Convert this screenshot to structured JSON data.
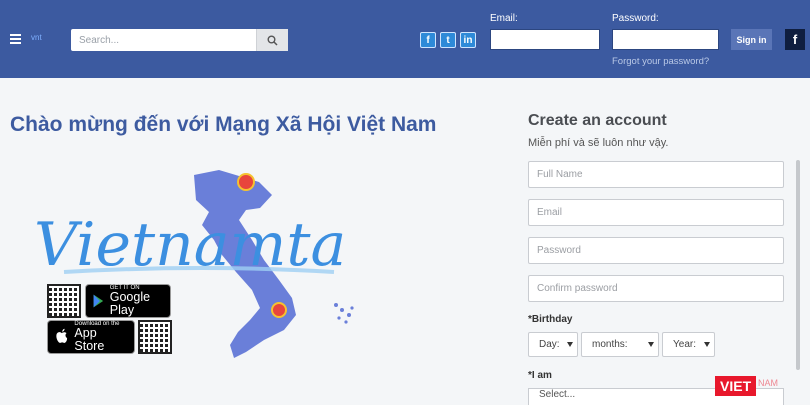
{
  "header": {
    "logo_text": "vnt",
    "search_placeholder": "Search...",
    "social": [
      "f",
      "t",
      "in"
    ],
    "email_label": "Email:",
    "password_label": "Password:",
    "signin_label": "Sign in",
    "fb_label": "f",
    "forgot_label": "Forgot your password?"
  },
  "main": {
    "welcome": "Chào mừng đến với Mạng Xã Hội Việt Nam",
    "brand_script": "Vietnamta",
    "google_play_small": "GET IT ON",
    "google_play_big": "Google Play",
    "app_store_small": "Download on the",
    "app_store_big": "App Store"
  },
  "register": {
    "title": "Create an account",
    "subtitle": "Miễn phí và sẽ luôn như vậy.",
    "full_name_placeholder": "Full Name",
    "email_placeholder": "Email",
    "password_placeholder": "Password",
    "confirm_placeholder": "Confirm password",
    "birthday_label": "*Birthday",
    "day_label": "Day:",
    "months_label": "months:",
    "year_label": "Year:",
    "i_am_label": "*I am",
    "gender_placeholder": "Select..."
  },
  "watermark": "VIET",
  "watermark_extra": "NAM",
  "colors": {
    "header_bg": "#3c5aa0",
    "title_blue": "#3d5ba0",
    "map_blue": "#6a7fd9",
    "script_blue": "#3c8fe0",
    "watermark_red": "#e8182c"
  }
}
